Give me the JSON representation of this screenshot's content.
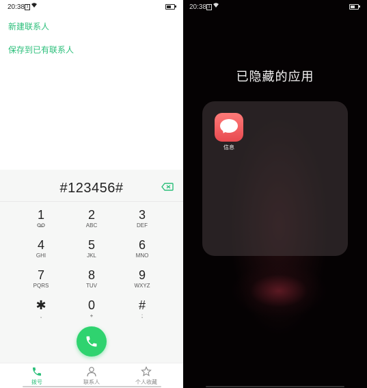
{
  "left_screen": {
    "status_bar": {
      "time": "20:38",
      "sim_badge": "1",
      "battery_level": 0.55
    },
    "actions": {
      "new_contact": "新建联系人",
      "save_to_existing": "保存到已有联系人"
    },
    "dial_input": "#123456#",
    "keypad": [
      {
        "digit": "1",
        "letters": "",
        "icon": "voicemail-icon"
      },
      {
        "digit": "2",
        "letters": "ABC"
      },
      {
        "digit": "3",
        "letters": "DEF"
      },
      {
        "digit": "4",
        "letters": "GHI"
      },
      {
        "digit": "5",
        "letters": "JKL"
      },
      {
        "digit": "6",
        "letters": "MNO"
      },
      {
        "digit": "7",
        "letters": "PQRS"
      },
      {
        "digit": "8",
        "letters": "TUV"
      },
      {
        "digit": "9",
        "letters": "WXYZ"
      },
      {
        "digit": "✱",
        "letters": ","
      },
      {
        "digit": "0",
        "letters": "+"
      },
      {
        "digit": "#",
        "letters": ";"
      }
    ],
    "bottom_nav": [
      {
        "label": "拨号",
        "icon": "phone-icon",
        "active": true
      },
      {
        "label": "联系人",
        "icon": "person-icon",
        "active": false
      },
      {
        "label": "个人收藏",
        "icon": "star-icon",
        "active": false
      }
    ],
    "accent_color": "#2bbf7a"
  },
  "right_screen": {
    "status_bar": {
      "time": "20:38",
      "sim_badge": "1",
      "battery_level": 0.55
    },
    "title": "已隐藏的应用",
    "apps": [
      {
        "label": "信息",
        "icon": "message-bubble-icon",
        "color": "#f05a5e"
      }
    ]
  }
}
